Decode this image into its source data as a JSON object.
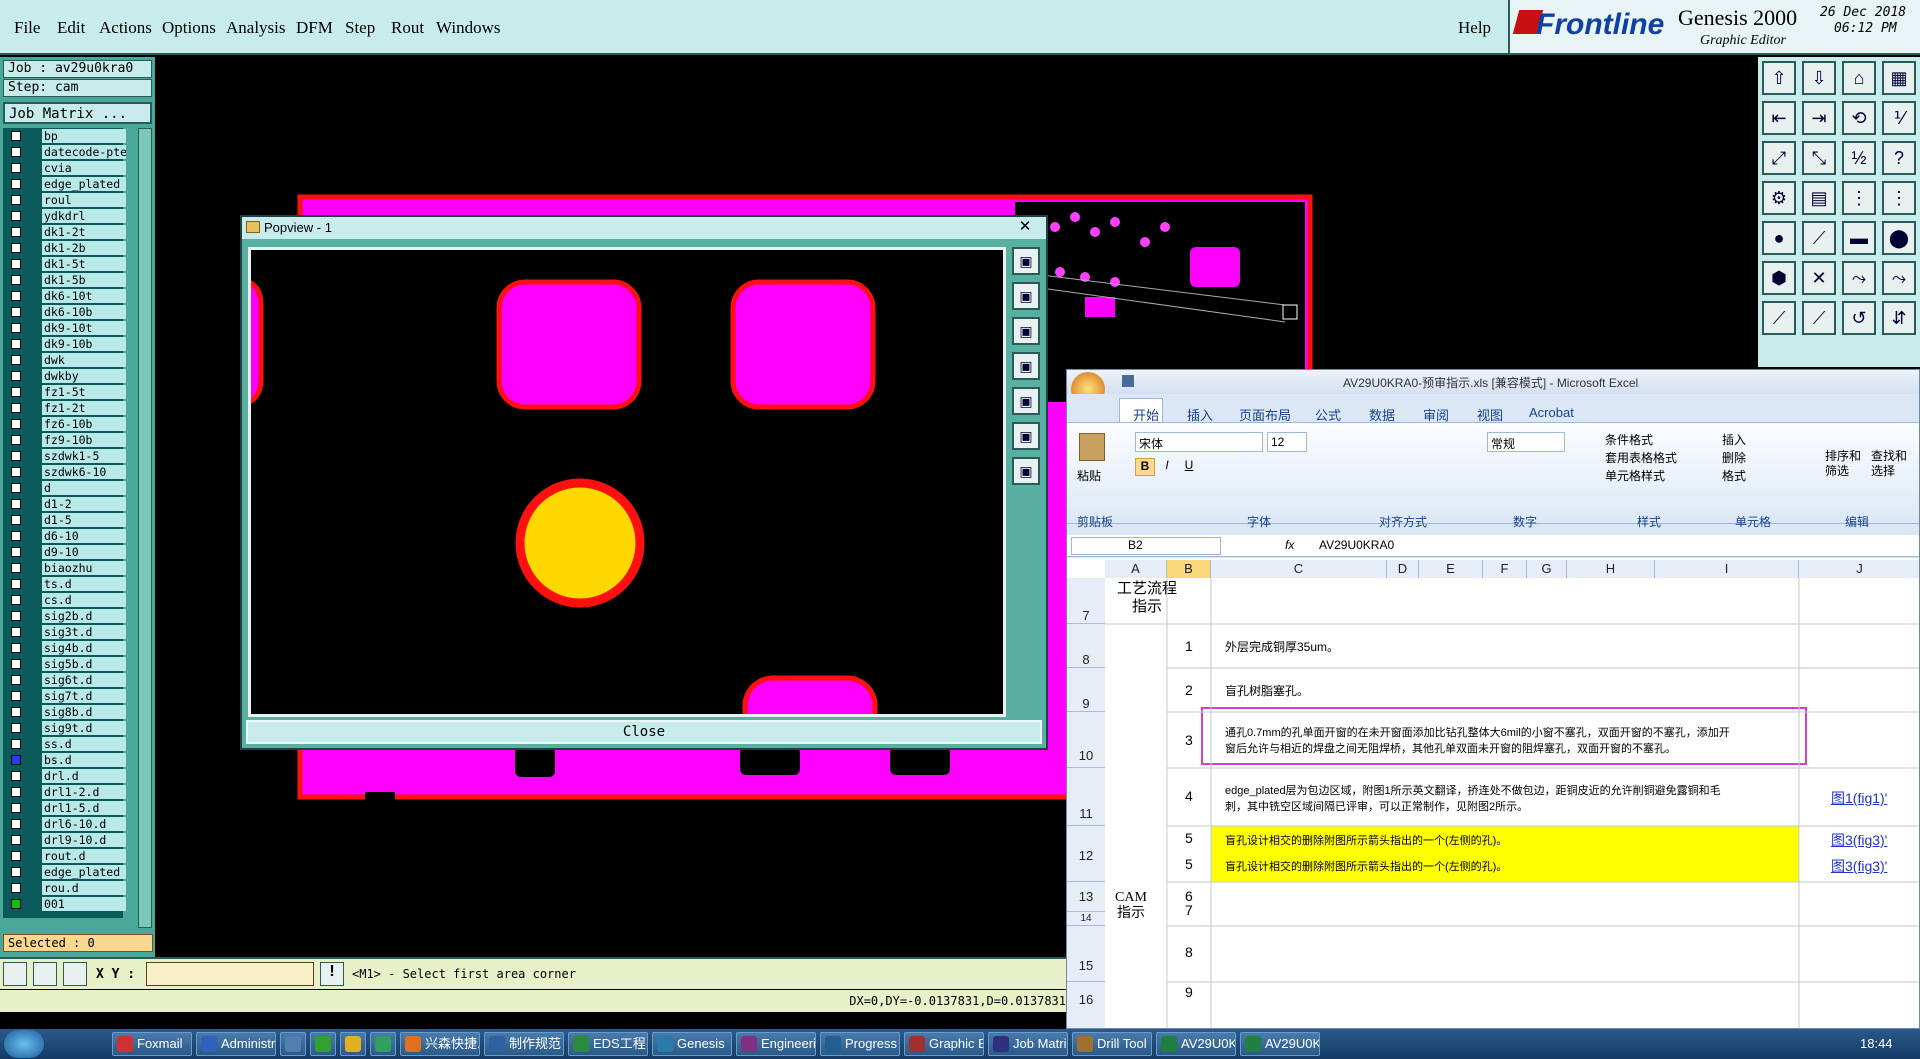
{
  "menu": {
    "items": [
      "File",
      "Edit",
      "Actions",
      "Options",
      "Analysis",
      "DFM",
      "Step",
      "Rout",
      "Windows"
    ],
    "help": "Help"
  },
  "brand": {
    "logo": "Frontline",
    "product": "Genesis 2000",
    "subtitle": "Graphic Editor",
    "date": "26 Dec 2018",
    "time": "06:12 PM"
  },
  "left": {
    "job": "Job : av29u0kra0",
    "step": "Step: cam",
    "matrix_button": "Job Matrix ...",
    "selected": "Selected : 0",
    "layers": [
      "bp",
      "datecode-pte",
      "cvia",
      "edge_plated",
      "roul",
      "ydkdrl",
      "dk1-2t",
      "dk1-2b",
      "dk1-5t",
      "dk1-5b",
      "dk6-10t",
      "dk6-10b",
      "dk9-10t",
      "dk9-10b",
      "dwk",
      "dwkby",
      "fz1-5t",
      "fz1-2t",
      "fz6-10b",
      "fz9-10b",
      "szdwk1-5",
      "szdwk6-10",
      "d",
      "d1-2",
      "d1-5",
      "d6-10",
      "d9-10",
      "biaozhu",
      "ts.d",
      "cs.d",
      "sig2b.d",
      "sig3t.d",
      "sig4b.d",
      "sig5b.d",
      "sig6t.d",
      "sig7t.d",
      "sig8b.d",
      "sig9t.d",
      "ss.d",
      "bs.d",
      "drl.d",
      "drl1-2.d",
      "drl1-5.d",
      "drl6-10.d",
      "drl9-10.d",
      "rout.d",
      "edge_plated",
      "rou.d",
      "001"
    ]
  },
  "cmd": {
    "xy_label": "X Y :",
    "xy_value": "",
    "prompt": "<M1> - Select first area corner",
    "status": "DX=0,DY=-0.0137831,D=0.0137831"
  },
  "popview": {
    "title": "Popview - 1",
    "close": "Close"
  },
  "excel": {
    "title": "AV29U0KRA0-预审指示.xls  [兼容模式] - Microsoft Excel",
    "tabs": [
      "开始",
      "插入",
      "页面布局",
      "公式",
      "数据",
      "审阅",
      "视图",
      "Acrobat"
    ],
    "font_name": "宋体",
    "font_size": "12",
    "number_format": "常规",
    "paste": "粘贴",
    "styles": [
      "条件格式",
      "套用表格格式",
      "单元格样式"
    ],
    "cells_cmds": [
      "插入",
      "删除",
      "格式"
    ],
    "edit_cmds": [
      "排序和\n筛选",
      "查找和\n选择"
    ],
    "groups": [
      "剪贴板",
      "字体",
      "对齐方式",
      "数字",
      "样式",
      "单元格",
      "编辑"
    ],
    "name_box": "B2",
    "formula": "AV29U0KRA0",
    "columns": [
      "A",
      "B",
      "C",
      "D",
      "E",
      "F",
      "G",
      "H",
      "I",
      "J"
    ],
    "rows": [
      {
        "num": "7",
        "b": "",
        "c": "",
        "header": "工艺流程\n指示"
      },
      {
        "num": "8",
        "b": "1",
        "c": "外层完成铜厚35um。"
      },
      {
        "num": "9",
        "b": "2",
        "c": "盲孔树脂塞孔。"
      },
      {
        "num": "10",
        "b": "3",
        "c": "通孔0.7mm的孔单面开窗的在未开窗面添加比钻孔整体大6mil的小窗不塞孔，双面开窗的不塞孔，添加开",
        "c2": "窗后允许与相近的焊盘之间无阻焊桥，其他孔单双面未开窗的阻焊塞孔，双面开窗的不塞孔。"
      },
      {
        "num": "11",
        "b": "4",
        "c": "edge_plated层为包边区域，附图1所示英文翻译，挢连处不做包边，距铜皮近的允许削铜避免露铜和毛",
        "c2": "刺，其中铣空区域间隔已评审，可以正常制作，见附图2所示。",
        "link": "图1(fig1)'"
      },
      {
        "num": "12",
        "b": "5",
        "c": "盲孔设计相交的删除附图所示箭头指出的一个(左侧的孔)。",
        "b2": "5",
        "c3": "盲孔设计相交的删除附图所示箭头指出的一个(左侧的孔)。",
        "link": "图3(fig3)'",
        "link2": "图3(fig3)'"
      },
      {
        "num": "13",
        "b": "6",
        "c": ""
      },
      {
        "num": "14",
        "b": "7",
        "c": ""
      },
      {
        "num": "15",
        "b": "8",
        "c": ""
      },
      {
        "num": "16",
        "b": "9",
        "c": ""
      }
    ],
    "cam_label": "CAM\n指示"
  },
  "taskbar": {
    "items": [
      "Foxmail",
      "Administr...",
      "",
      "",
      "",
      "",
      "兴森快捷...",
      "制作规范 (...",
      "EDS工程...",
      "Genesis",
      "Engineeri...",
      "Progress",
      "Graphic E...",
      "Job Matri...",
      "Drill Tool ...",
      "AV29U0K...",
      "AV29U0K..."
    ],
    "clock": "18:44"
  }
}
